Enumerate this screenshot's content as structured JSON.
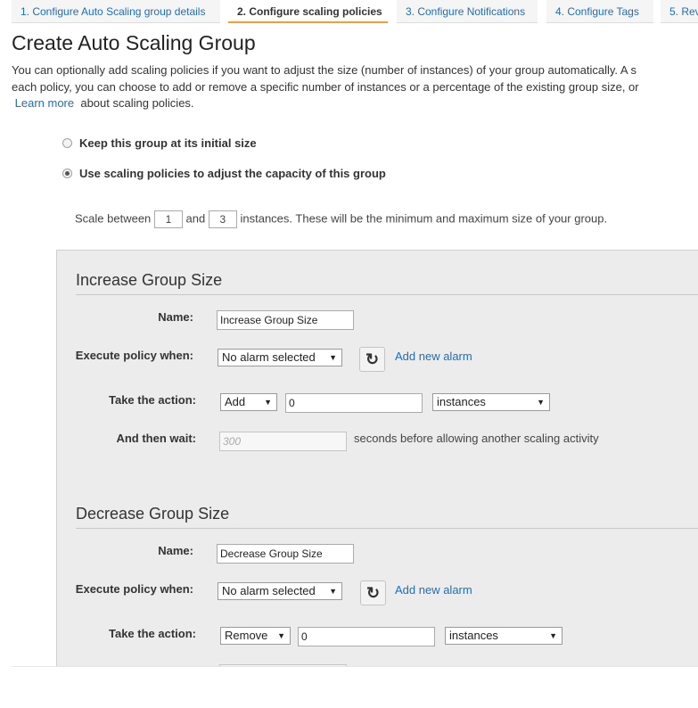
{
  "wizard": {
    "steps": [
      {
        "label": "1. Configure Auto Scaling group details"
      },
      {
        "label": "2. Configure scaling policies"
      },
      {
        "label": "3. Configure Notifications"
      },
      {
        "label": "4. Configure Tags"
      },
      {
        "label": "5. Rev"
      }
    ],
    "active_step": 1
  },
  "page": {
    "title": "Create Auto Scaling Group",
    "intro_line1": "You can optionally add scaling policies if you want to adjust the size (number of instances) of your group automatically. A s",
    "intro_line2": "each policy, you can choose to add or remove a specific number of instances or a percentage of the existing group size, or",
    "learn_more": "Learn more",
    "intro_line3_rest": "about scaling policies."
  },
  "options": {
    "keep_initial": "Keep this group at its initial size",
    "use_policies": "Use scaling policies to adjust the capacity of this group",
    "selected": "use_policies"
  },
  "scale": {
    "prefix": "Scale between",
    "min": "1",
    "and": "and",
    "max": "3",
    "suffix": "instances. These will be the minimum and maximum size of your group."
  },
  "increase": {
    "title": "Increase Group Size",
    "name_label": "Name:",
    "name_value": "Increase Group Size",
    "execute_label": "Execute policy when:",
    "alarm_value": "No alarm selected",
    "add_alarm": "Add new alarm",
    "action_label": "Take the action:",
    "action_value": "Add",
    "amount_value": "0",
    "unit_value": "instances",
    "wait_label": "And then wait:",
    "wait_placeholder": "300",
    "wait_note": "seconds before allowing another scaling activity"
  },
  "decrease": {
    "title": "Decrease Group Size",
    "name_label": "Name:",
    "name_value": "Decrease Group Size",
    "execute_label": "Execute policy when:",
    "alarm_value": "No alarm selected",
    "add_alarm": "Add new alarm",
    "action_label": "Take the action:",
    "action_value": "Remove",
    "amount_value": "0",
    "unit_value": "instances"
  }
}
